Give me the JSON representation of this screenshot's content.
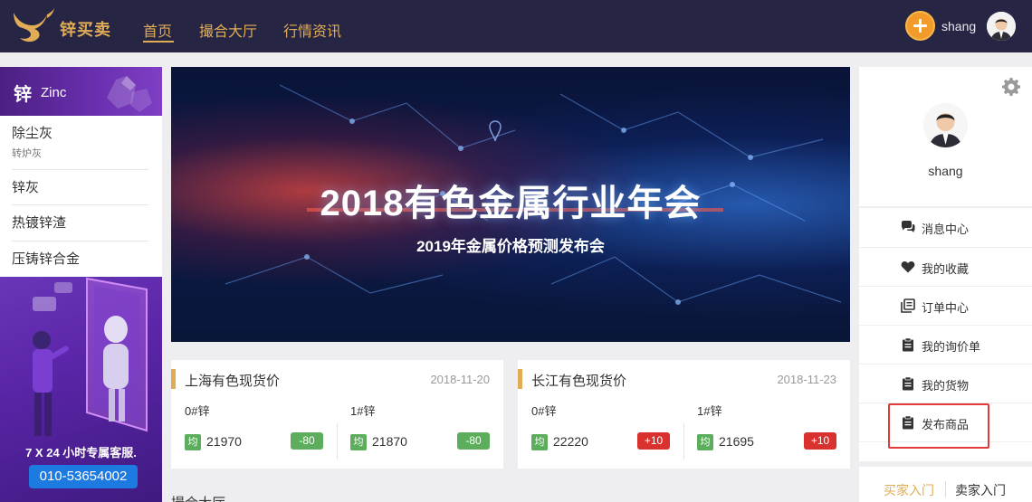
{
  "header": {
    "brand": "锌买卖",
    "nav": [
      "首页",
      "撮合大厅",
      "行情资讯"
    ],
    "username": "shang"
  },
  "category": {
    "name_cn": "锌",
    "name_en": "Zinc",
    "items": [
      {
        "label": "除尘灰",
        "sub": "转炉灰"
      },
      {
        "label": "锌灰"
      },
      {
        "label": "热镀锌渣"
      },
      {
        "label": "压铸锌合金"
      }
    ]
  },
  "promo": {
    "text": "7 X 24 小时专属客服.",
    "phone": "010-53654002"
  },
  "banner": {
    "title": "2018有色金属行业年会",
    "subtitle": "2019年金属价格预测发布会"
  },
  "price_cards": [
    {
      "title": "上海有色现货价",
      "date": "2018-11-20",
      "columns": [
        {
          "name": "0#锌",
          "badge": "均",
          "price": "21970",
          "change": "-80",
          "direction": "down"
        },
        {
          "name": "1#锌",
          "badge": "均",
          "price": "21870",
          "change": "-80",
          "direction": "down"
        }
      ]
    },
    {
      "title": "长江有色现货价",
      "date": "2018-11-23",
      "columns": [
        {
          "name": "0#锌",
          "badge": "均",
          "price": "22220",
          "change": "+10",
          "direction": "up"
        },
        {
          "name": "1#锌",
          "badge": "均",
          "price": "21695",
          "change": "+10",
          "direction": "up"
        }
      ]
    }
  ],
  "more_section": "撮合大厅",
  "profile": {
    "username": "shang"
  },
  "menu": [
    {
      "label": "消息中心",
      "icon": "chat-icon"
    },
    {
      "label": "我的收藏",
      "icon": "heart-icon"
    },
    {
      "label": "订单中心",
      "icon": "orders-icon"
    },
    {
      "label": "我的询价单",
      "icon": "clipboard-icon"
    },
    {
      "label": "我的货物",
      "icon": "clipboard-icon"
    },
    {
      "label": "发布商品",
      "icon": "clipboard-icon"
    }
  ],
  "auth": {
    "buyer": "买家入门",
    "seller": "卖家入门"
  },
  "colors": {
    "header_bg": "#272544",
    "accent_gold": "#e0ac55",
    "down_green": "#5cae5c",
    "up_red": "#d9322e",
    "highlight_red": "#e23a3a",
    "category_purple": "#6a2fb0"
  }
}
